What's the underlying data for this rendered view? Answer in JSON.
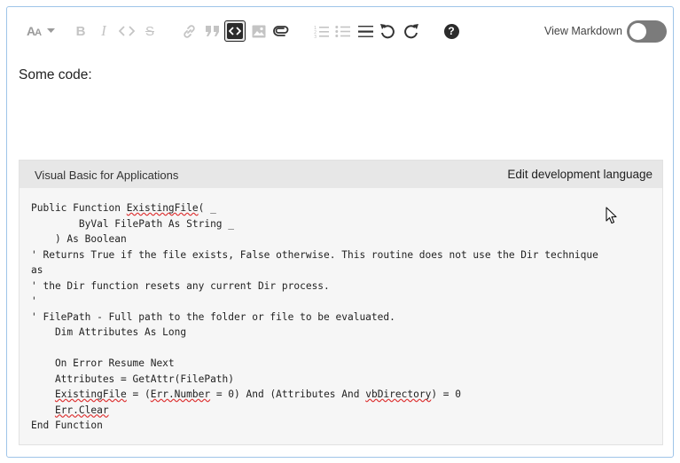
{
  "toolbar": {
    "buttons": [
      {
        "name": "font-size-icon",
        "glyph": "AA"
      },
      {
        "name": "bold-icon",
        "glyph": "B"
      },
      {
        "name": "italic-icon",
        "glyph": "I"
      },
      {
        "name": "code-icon"
      },
      {
        "name": "strikethrough-icon",
        "glyph": "S"
      },
      {
        "name": "link-icon"
      },
      {
        "name": "quote-icon"
      },
      {
        "name": "code-block-icon"
      },
      {
        "name": "image-icon"
      },
      {
        "name": "attachment-icon"
      },
      {
        "name": "numbered-list-icon"
      },
      {
        "name": "bulleted-list-icon"
      },
      {
        "name": "horizontal-rule-icon"
      },
      {
        "name": "undo-icon"
      },
      {
        "name": "redo-icon"
      },
      {
        "name": "help-icon",
        "glyph": "?"
      }
    ],
    "view_markdown_label": "View Markdown",
    "view_markdown_on": false
  },
  "content": {
    "paragraph": "Some code:"
  },
  "code_block": {
    "language": "Visual Basic for Applications",
    "edit_language_label": "Edit development language",
    "lines": [
      "Public Function ExistingFile( _",
      "        ByVal FilePath As String _",
      "    ) As Boolean",
      "' Returns True if the file exists, False otherwise. This routine does not use the Dir technique",
      "as",
      "' the Dir function resets any current Dir process.",
      "'",
      "' FilePath - Full path to the folder or file to be evaluated.",
      "    Dim Attributes As Long",
      "",
      "    On Error Resume Next",
      "    Attributes = GetAttr(FilePath)",
      "    ExistingFile = (Err.Number = 0) And (Attributes And vbDirectory) = 0",
      "    Err.Clear",
      "End Function"
    ],
    "spellcheck_words": [
      "ExistingFile",
      "Err.Number",
      "vbDirectory",
      "Err.Clear"
    ]
  },
  "colors": {
    "border": "#9fc5e8",
    "toggle_off": "#7b7b7b",
    "code_bg": "#f6f6f6",
    "code_header_bg": "#e7e7e7",
    "squiggle": "#d33"
  }
}
